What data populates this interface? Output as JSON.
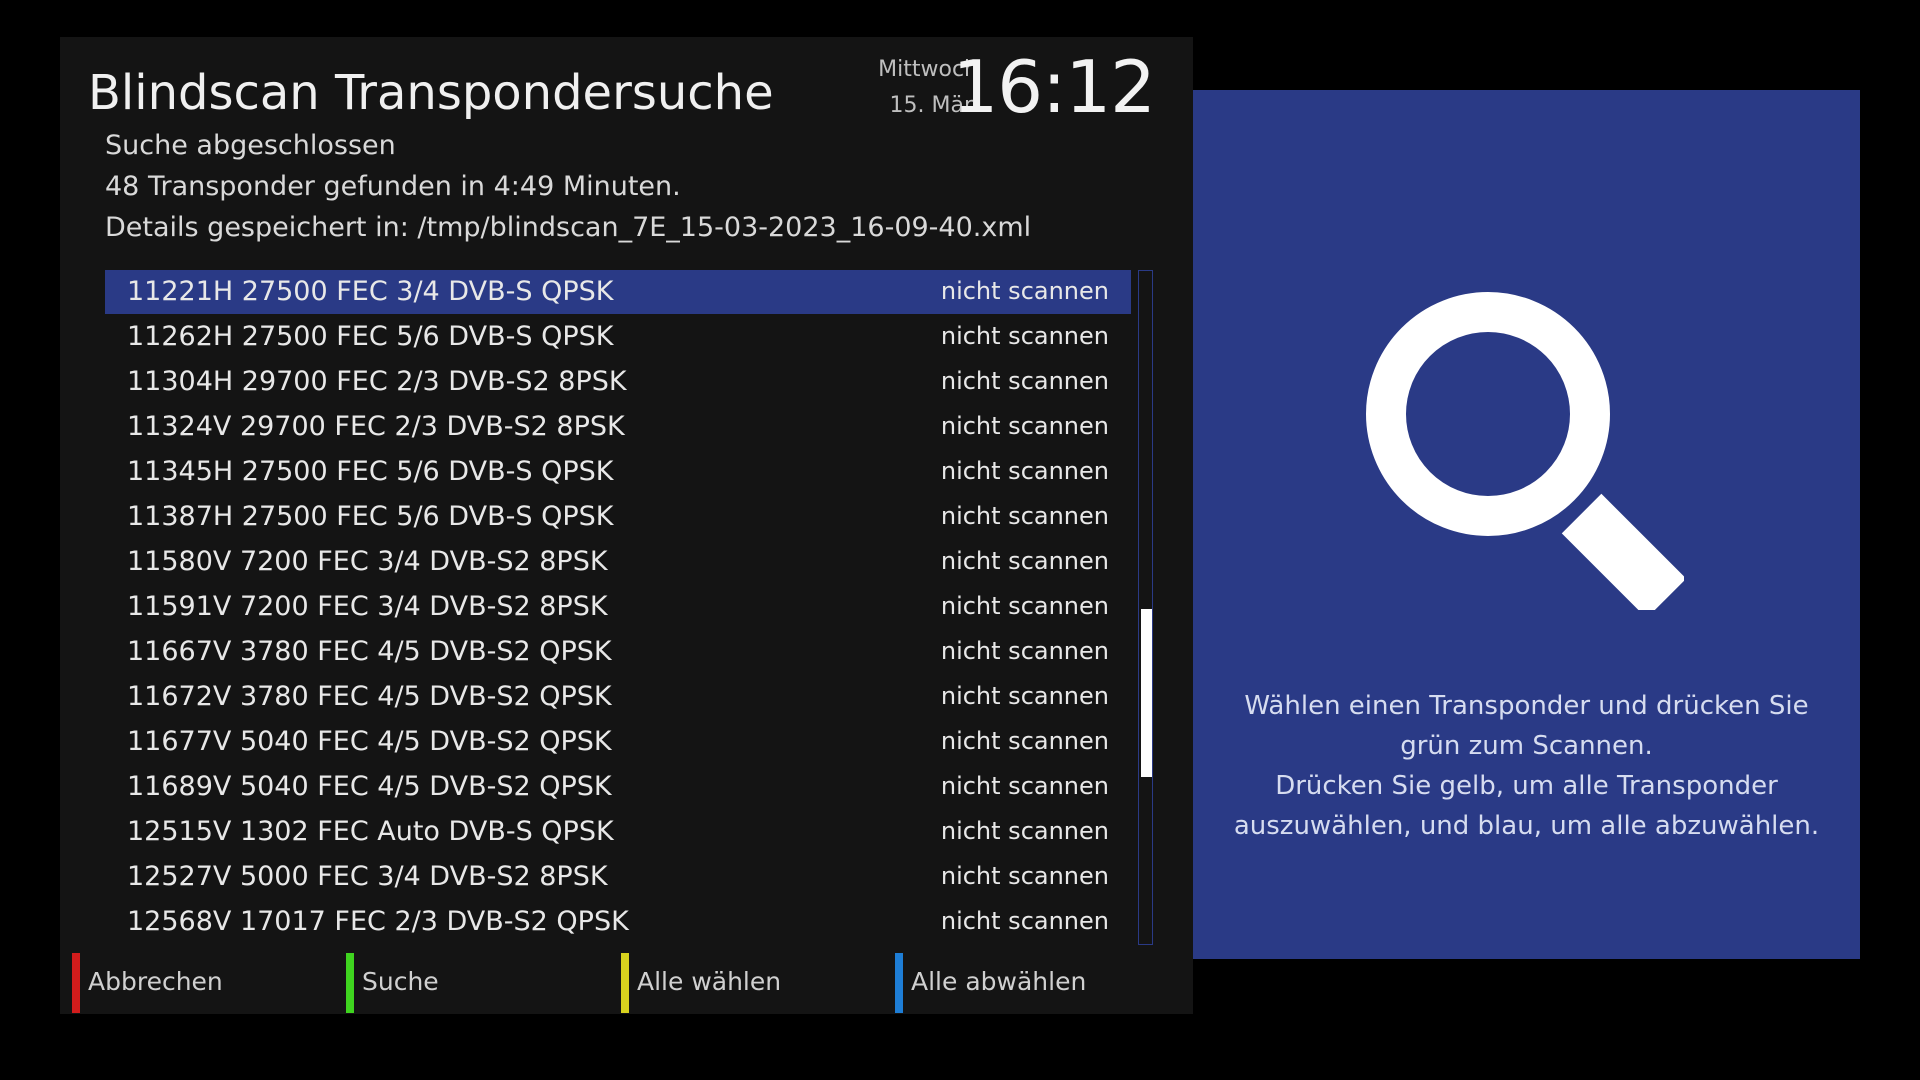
{
  "header": {
    "title": "Blindscan Transpondersuche",
    "weekday": "Mittwoch",
    "date": "15. Mär.",
    "time": "16:12"
  },
  "status": {
    "line1": "Suche abgeschlossen",
    "line2": "48 Transponder gefunden in 4:49 Minuten.",
    "line3": "Details gespeichert in: /tmp/blindscan_7E_15-03-2023_16-09-40.xml"
  },
  "transponders": [
    {
      "label": "11221H 27500 FEC 3/4 DVB-S QPSK",
      "action": "nicht scannen"
    },
    {
      "label": "11262H 27500 FEC 5/6 DVB-S QPSK",
      "action": "nicht scannen"
    },
    {
      "label": "11304H 29700 FEC 2/3 DVB-S2 8PSK",
      "action": "nicht scannen"
    },
    {
      "label": "11324V 29700 FEC 2/3 DVB-S2 8PSK",
      "action": "nicht scannen"
    },
    {
      "label": "11345H 27500 FEC 5/6 DVB-S QPSK",
      "action": "nicht scannen"
    },
    {
      "label": "11387H 27500 FEC 5/6 DVB-S QPSK",
      "action": "nicht scannen"
    },
    {
      "label": "11580V 7200 FEC 3/4 DVB-S2 8PSK",
      "action": "nicht scannen"
    },
    {
      "label": "11591V 7200 FEC 3/4 DVB-S2 8PSK",
      "action": "nicht scannen"
    },
    {
      "label": "11667V 3780 FEC 4/5 DVB-S2 QPSK",
      "action": "nicht scannen"
    },
    {
      "label": "11672V 3780 FEC 4/5 DVB-S2 QPSK",
      "action": "nicht scannen"
    },
    {
      "label": "11677V 5040 FEC 4/5 DVB-S2 QPSK",
      "action": "nicht scannen"
    },
    {
      "label": "11689V 5040 FEC 4/5 DVB-S2 QPSK",
      "action": "nicht scannen"
    },
    {
      "label": "12515V 1302 FEC Auto DVB-S QPSK",
      "action": "nicht scannen"
    },
    {
      "label": "12527V 5000 FEC 3/4 DVB-S2 8PSK",
      "action": "nicht scannen"
    },
    {
      "label": "12568V 17017 FEC 2/3 DVB-S2 QPSK",
      "action": "nicht scannen"
    }
  ],
  "selected_index": 0,
  "buttons": {
    "red": {
      "label": "Abbrechen",
      "color": "#d21c1c"
    },
    "green": {
      "label": "Suche",
      "color": "#3fd41f"
    },
    "yellow": {
      "label": "Alle wählen",
      "color": "#d8d21e"
    },
    "blue": {
      "label": "Alle abwählen",
      "color": "#1e7ed6"
    }
  },
  "info": {
    "icon": "magnifier-icon",
    "line1": "Wählen einen Transponder und drücken Sie grün zum Scannen.",
    "line2": "Drücken Sie gelb, um alle Transponder auszuwählen, und blau, um alle abzuwählen."
  },
  "colors": {
    "accent": "#2a3a86",
    "panel_background": "#141414"
  }
}
